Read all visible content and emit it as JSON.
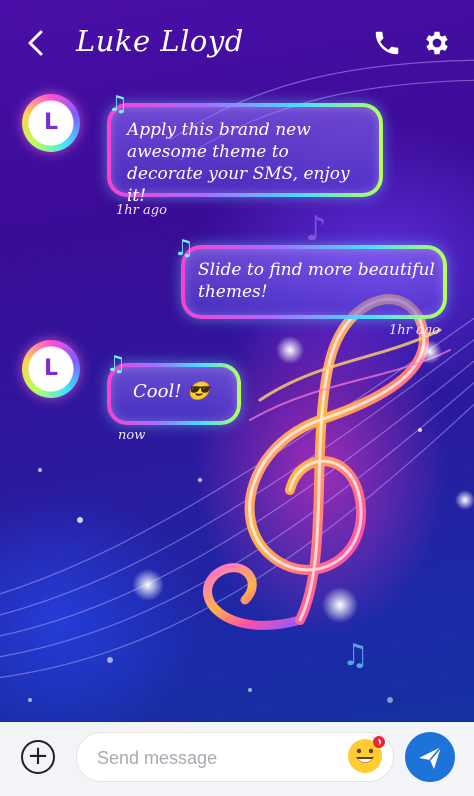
{
  "header": {
    "back_icon": "chevron-left-icon",
    "contact_name": "Luke Lloyd",
    "call_icon": "phone-icon",
    "settings_icon": "gear-icon"
  },
  "messages": [
    {
      "direction": "incoming",
      "avatar_initial": "L",
      "text": "Apply this brand new awesome theme to decorate your SMS, enjoy it!",
      "time": "1hr ago"
    },
    {
      "direction": "outgoing",
      "text": "Slide to find more beautiful themes!",
      "time": "1hr ago"
    },
    {
      "direction": "incoming",
      "avatar_initial": "L",
      "text": "Cool! 😎",
      "time": "now"
    }
  ],
  "composer": {
    "add_icon": "plus-circle-icon",
    "placeholder": "Send message",
    "emoji_icon": "grinning-face-icon",
    "send_icon": "paper-plane-icon"
  },
  "colors": {
    "background_top": "#4a0fa8",
    "background_bottom": "#1530a0",
    "send_button": "#1e73d8",
    "composer_bar": "#f3f4f8"
  }
}
